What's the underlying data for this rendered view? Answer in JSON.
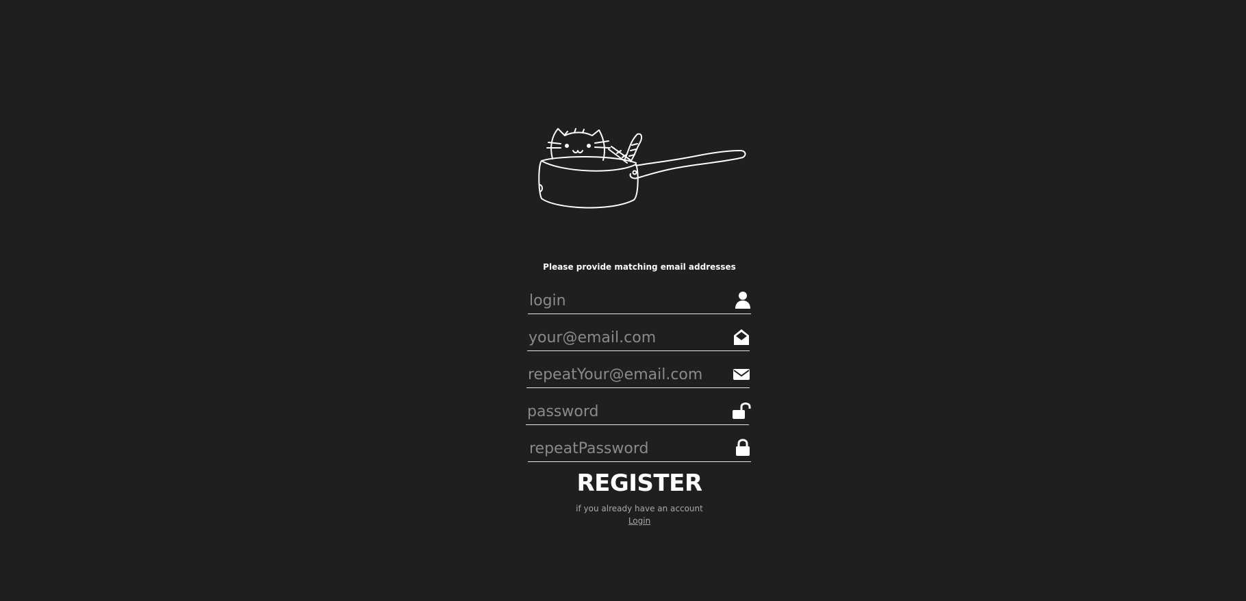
{
  "form": {
    "message": "Please provide matching email addresses",
    "fields": {
      "login": {
        "placeholder": "login",
        "icon": "user-icon"
      },
      "email": {
        "placeholder": "your@email.com",
        "icon": "envelope-open-icon"
      },
      "repeat_email": {
        "placeholder": "repeatYour@email.com",
        "icon": "envelope-icon"
      },
      "password": {
        "placeholder": "password",
        "icon": "lock-open-icon"
      },
      "repeat_password": {
        "placeholder": "repeatPassword",
        "icon": "lock-icon"
      }
    },
    "submit_label": "REGISTER",
    "account_hint": "if you already have an account",
    "login_link": "Login"
  },
  "colors": {
    "background": "#1f1f1f",
    "text": "#ffffff",
    "placeholder": "#8a8a8a",
    "muted": "#a8a8a8"
  }
}
